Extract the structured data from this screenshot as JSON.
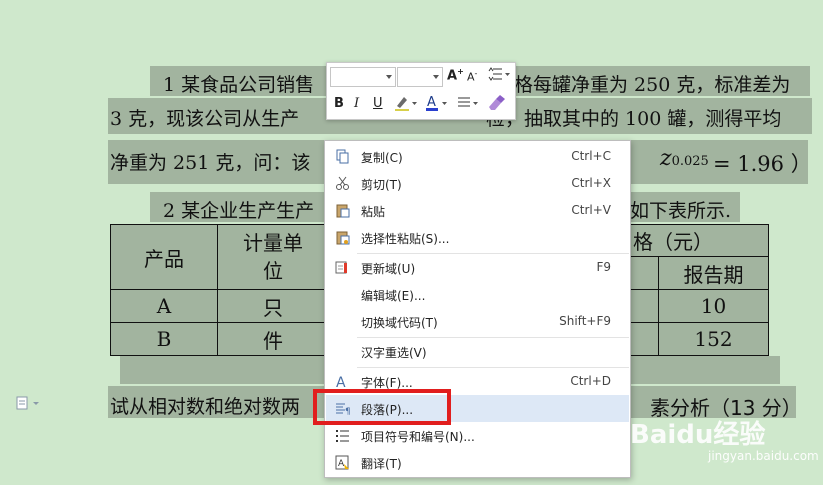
{
  "document": {
    "para1_line1": "1 某食品公司销售",
    "para1_line1_right": "格每罐净重为 250 克，标准差为",
    "para1_line2_left": "3 克，现该公司从生产",
    "para1_line2_right": "检，抽取其中的 100 罐，测得平均",
    "para1_line3_left": "净重为 251 克，问：该",
    "para1_formula": "z",
    "para1_formula_sub": "0.025",
    "para1_formula_rest": "= 1.96 ）",
    "para2_left": "2 某企业生产生产",
    "para2_right": "如下表所示.",
    "final_left": "试从相对数和绝对数两",
    "final_right": "素分析（13 分）"
  },
  "table": {
    "col_product": "产品",
    "col_unit": "计量单位",
    "col_price": "格（元）",
    "col_report": "报告期",
    "rows": [
      {
        "product": "A",
        "unit": "只",
        "report": "10"
      },
      {
        "product": "B",
        "unit": "件",
        "report": "152"
      }
    ]
  },
  "mini_toolbar": {
    "bold": "B",
    "italic": "I",
    "underline": "U"
  },
  "context_menu": {
    "items": [
      {
        "label": "复制(C)",
        "shortcut": "Ctrl+C",
        "icon": "copy-icon"
      },
      {
        "label": "剪切(T)",
        "shortcut": "Ctrl+X",
        "icon": "cut-icon"
      },
      {
        "label": "粘贴",
        "shortcut": "Ctrl+V",
        "icon": "paste-icon"
      },
      {
        "label": "选择性粘贴(S)...",
        "shortcut": "",
        "icon": "paste-special-icon"
      },
      {
        "label": "更新域(U)",
        "shortcut": "F9",
        "icon": "update-field-icon"
      },
      {
        "label": "编辑域(E)...",
        "shortcut": "",
        "icon": ""
      },
      {
        "label": "切换域代码(T)",
        "shortcut": "Shift+F9",
        "icon": ""
      },
      {
        "label": "汉字重选(V)",
        "shortcut": "",
        "icon": ""
      },
      {
        "label": "字体(F)...",
        "shortcut": "Ctrl+D",
        "icon": "font-icon"
      },
      {
        "label": "段落(P)...",
        "shortcut": "",
        "icon": "paragraph-icon"
      },
      {
        "label": "项目符号和编号(N)...",
        "shortcut": "",
        "icon": "bullets-icon"
      },
      {
        "label": "翻译(T)",
        "shortcut": "",
        "icon": "translate-icon"
      }
    ]
  },
  "watermark": {
    "brand": "Baidu经验",
    "url": "jingyan.baidu.com"
  },
  "colors": {
    "background": "#cfe8cc",
    "selection": "#a2b49f",
    "highlight_box": "#e11e1e",
    "menu_hover": "#dde8f6"
  }
}
